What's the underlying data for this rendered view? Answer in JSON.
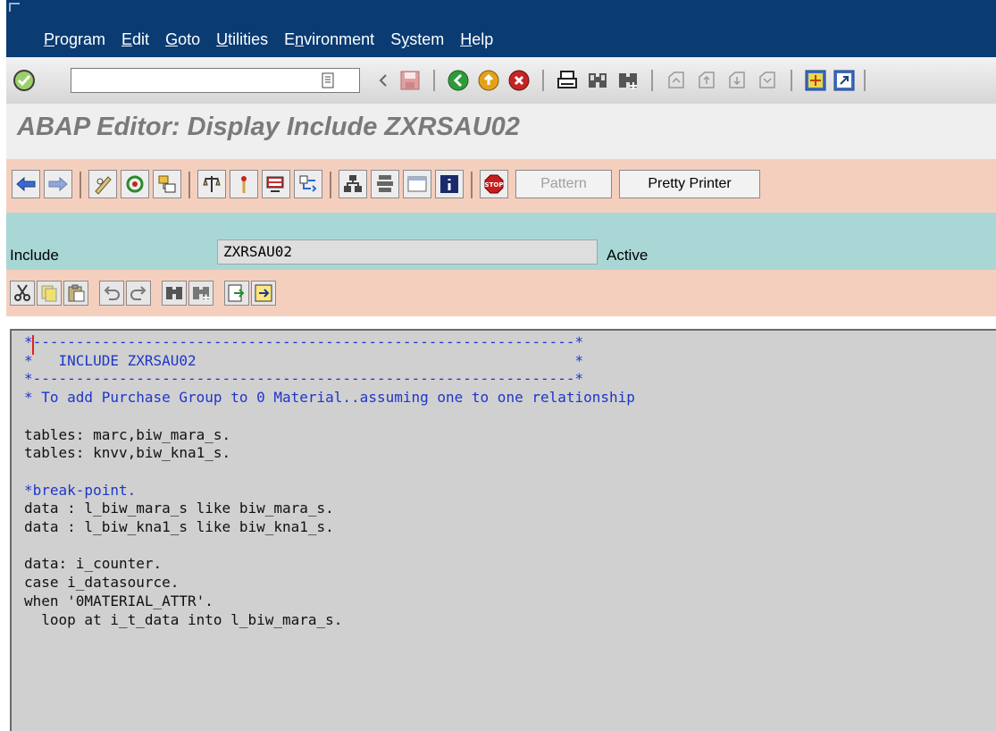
{
  "menu": {
    "items": [
      {
        "pre": "",
        "u": "P",
        "post": "rogram"
      },
      {
        "pre": "",
        "u": "E",
        "post": "dit"
      },
      {
        "pre": "",
        "u": "G",
        "post": "oto"
      },
      {
        "pre": "",
        "u": "U",
        "post": "tilities"
      },
      {
        "pre": "E",
        "u": "n",
        "post": "vironment"
      },
      {
        "pre": "S",
        "u": "y",
        "post": "stem"
      },
      {
        "pre": "",
        "u": "H",
        "post": "elp"
      }
    ]
  },
  "command_field": {
    "value": ""
  },
  "title": "ABAP Editor: Display Include ZXRSAU02",
  "app_toolbar": {
    "pattern_label": "Pattern",
    "pretty_printer_label": "Pretty Printer"
  },
  "include_row": {
    "label": "Include",
    "value": "ZXRSAU02",
    "status": "Active"
  },
  "code": {
    "lines": [
      {
        "t": "*---------------------------------------------------------------*",
        "k": "c"
      },
      {
        "t": "*   INCLUDE ZXRSAU02                                            *",
        "k": "c"
      },
      {
        "t": "*---------------------------------------------------------------*",
        "k": "c"
      },
      {
        "t": "* To add Purchase Group to 0 Material..assuming one to one relationship",
        "k": "c"
      },
      {
        "t": "",
        "k": "n"
      },
      {
        "t": "tables: marc,biw_mara_s.",
        "k": "n"
      },
      {
        "t": "tables: knvv,biw_kna1_s.",
        "k": "n"
      },
      {
        "t": "",
        "k": "n"
      },
      {
        "t": "*break-point.",
        "k": "c"
      },
      {
        "t": "data : l_biw_mara_s like biw_mara_s.",
        "k": "n"
      },
      {
        "t": "data : l_biw_kna1_s like biw_kna1_s.",
        "k": "n"
      },
      {
        "t": "",
        "k": "n"
      },
      {
        "t": "data: i_counter.",
        "k": "n"
      },
      {
        "t": "case i_datasource.",
        "k": "n"
      },
      {
        "t": "when '0MATERIAL_ATTR'.",
        "k": "n"
      },
      {
        "t": "  loop at i_t_data into l_biw_mara_s.",
        "k": "n"
      }
    ]
  }
}
